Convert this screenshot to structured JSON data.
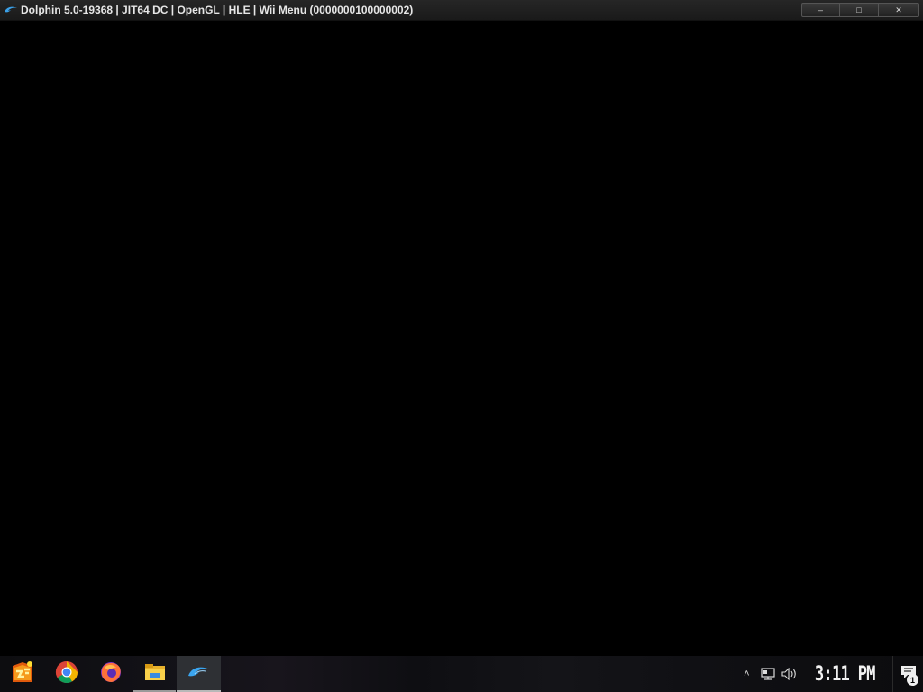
{
  "window": {
    "title": "Dolphin 5.0-19368 | JIT64 DC | OpenGL | HLE | Wii Menu (0000000100000002)",
    "controls": {
      "minimize": "–",
      "maximize": "□",
      "close": "✕"
    }
  },
  "taskbar": {
    "apps": [
      {
        "name": "launcher",
        "icon": "star-burst-app-icon"
      },
      {
        "name": "Google Chrome",
        "icon": "chrome-icon"
      },
      {
        "name": "Firefox",
        "icon": "firefox-icon"
      },
      {
        "name": "File Explorer",
        "icon": "folder-icon"
      },
      {
        "name": "Dolphin",
        "icon": "dolphin-icon"
      }
    ],
    "tray": {
      "show_hidden": "˄",
      "clock": "3:11 PM",
      "notification_count": "1"
    }
  }
}
